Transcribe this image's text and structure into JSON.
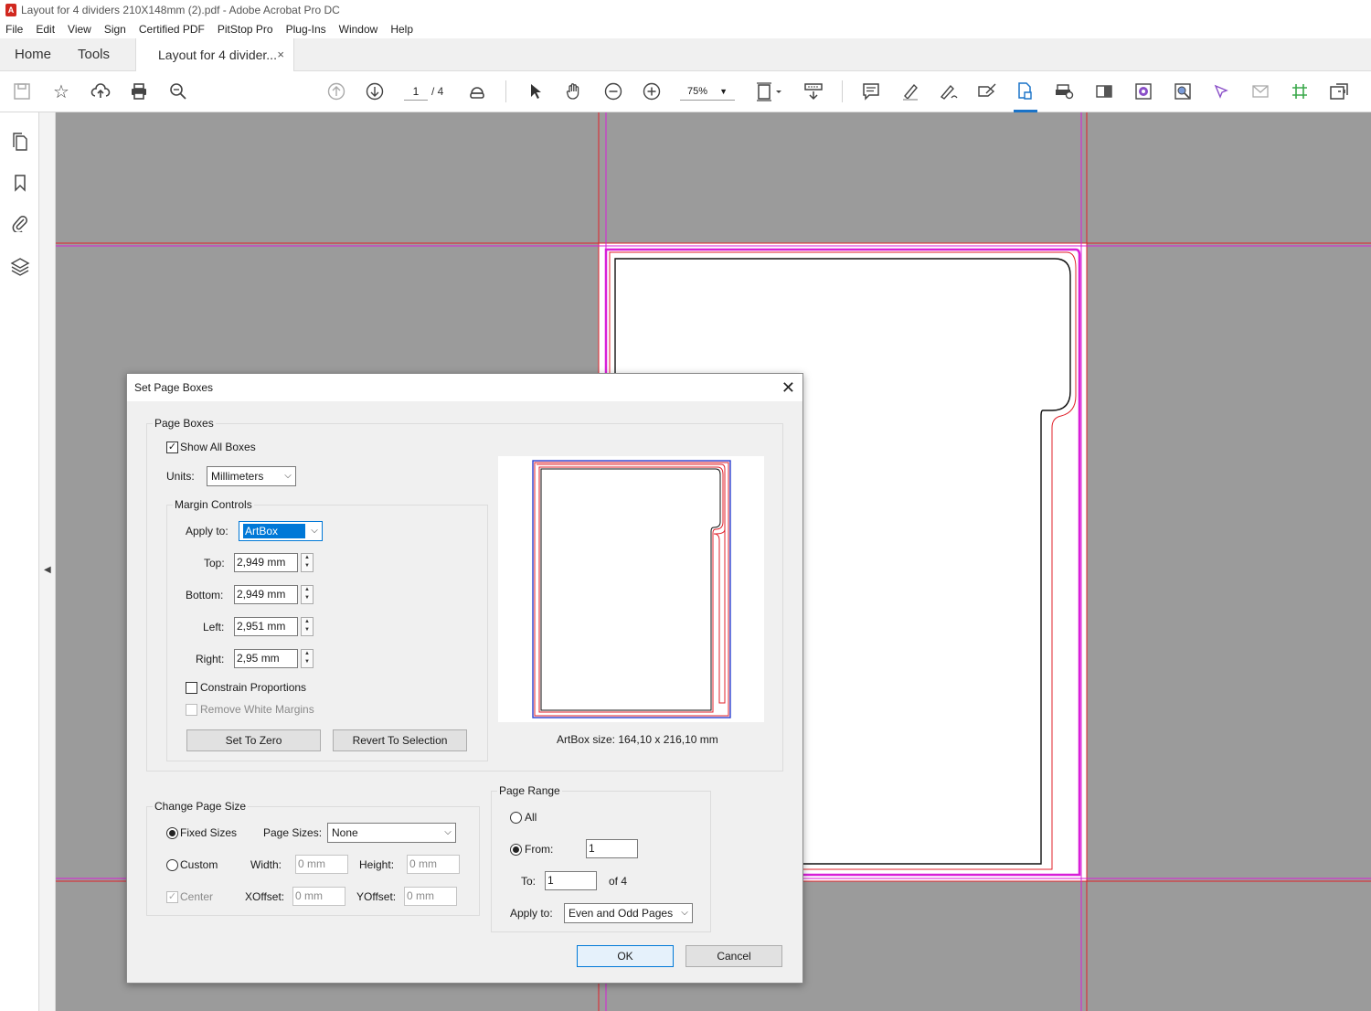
{
  "window": {
    "title": "Layout for 4 dividers 210X148mm (2).pdf - Adobe Acrobat Pro DC"
  },
  "menu": [
    "File",
    "Edit",
    "View",
    "Sign",
    "Certified PDF",
    "PitStop Pro",
    "Plug-Ins",
    "Window",
    "Help"
  ],
  "tabs": {
    "home": "Home",
    "tools": "Tools",
    "doc": "Layout for 4 divider...",
    "close": "×"
  },
  "toolbar": {
    "page_current": "1",
    "page_total": "/ 4",
    "zoom": "75%"
  },
  "colors": {
    "trim_line": "#e0202a",
    "bleed_box": "#d81fd8",
    "art_box_blue": "#2a3fcf",
    "selection": "#0078d7",
    "canvas_bg": "#9b9b9b"
  },
  "dialog": {
    "title": "Set Page Boxes",
    "close": "✕",
    "page_boxes": {
      "legend": "Page Boxes",
      "show_all_boxes": "Show All Boxes",
      "show_all_checked": true,
      "units_label": "Units:",
      "units_value": "Millimeters",
      "margin_controls": {
        "legend": "Margin Controls",
        "apply_to_label": "Apply to:",
        "apply_to_value": "ArtBox",
        "top_label": "Top:",
        "top_value": "2,949 mm",
        "bottom_label": "Bottom:",
        "bottom_value": "2,949 mm",
        "left_label": "Left:",
        "left_value": "2,951 mm",
        "right_label": "Right:",
        "right_value": "2,95 mm",
        "constrain": "Constrain Proportions",
        "remove_white": "Remove White Margins",
        "set_to_zero": "Set To Zero",
        "revert": "Revert To Selection"
      },
      "preview_caption": "ArtBox size: 164,10 x 216,10 mm"
    },
    "change_page_size": {
      "legend": "Change Page Size",
      "fixed_sizes": "Fixed Sizes",
      "page_sizes_label": "Page Sizes:",
      "page_sizes_value": "None",
      "custom": "Custom",
      "width_label": "Width:",
      "width_value": "0 mm",
      "height_label": "Height:",
      "height_value": "0 mm",
      "center": "Center",
      "xoffset_label": "XOffset:",
      "xoffset_value": "0 mm",
      "yoffset_label": "YOffset:",
      "yoffset_value": "0 mm"
    },
    "page_range": {
      "legend": "Page Range",
      "all": "All",
      "from_label": "From:",
      "from_value": "1",
      "to_label": "To:",
      "to_value": "1",
      "of_total": "of 4",
      "apply_to_label": "Apply to:",
      "apply_to_value": "Even and Odd Pages"
    },
    "ok": "OK",
    "cancel": "Cancel"
  }
}
